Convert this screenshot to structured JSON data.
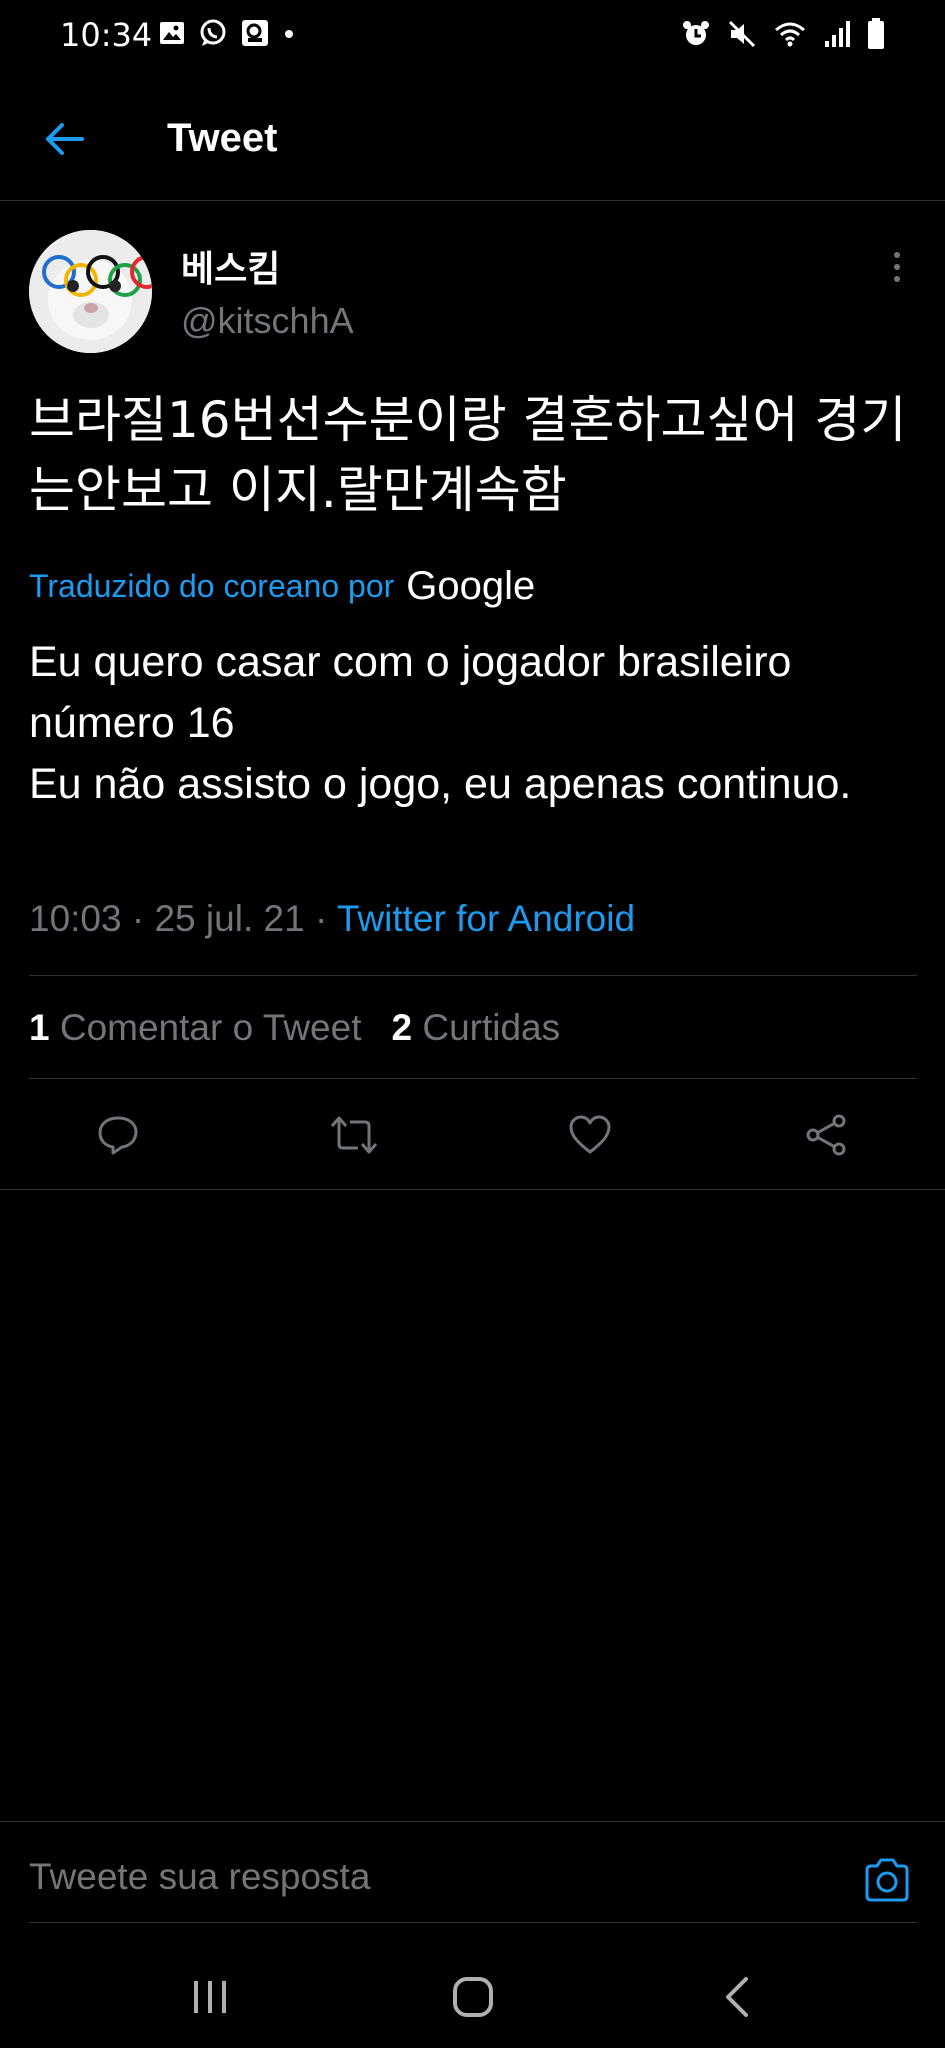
{
  "status_bar": {
    "time": "10:34",
    "left_icons": [
      "image-icon",
      "whatsapp-icon",
      "gallery-icon",
      "dot-icon"
    ],
    "right_icons": [
      "alarm-icon",
      "mute-icon",
      "wifi-icon",
      "signal-icon",
      "battery-icon"
    ]
  },
  "header": {
    "title": "Tweet",
    "back_icon": "arrow-left-icon"
  },
  "author": {
    "display_name": "베스킴",
    "handle": "@kitschhA"
  },
  "tweet": {
    "text": "브라질16번선수분이랑 결혼하고싶어 경기는안보고 이지.랄만계속함",
    "translated_by": "Traduzido do coreano por",
    "translator": "Google",
    "translation": "Eu quero casar com o jogador brasileiro número 16\n Eu não assisto o jogo, eu apenas continuo.",
    "time": "10:03",
    "date": "25 jul. 21",
    "source": "Twitter for Android"
  },
  "stats": {
    "comments_count": "1",
    "comments_label": "Comentar o Tweet",
    "likes_count": "2",
    "likes_label": "Curtidas"
  },
  "actions": [
    "reply-icon",
    "retweet-icon",
    "like-icon",
    "share-icon"
  ],
  "reply": {
    "placeholder": "Tweete sua resposta"
  },
  "colors": {
    "accent": "#1d9bf0",
    "background": "#000000",
    "muted": "#71767b",
    "divider": "#2f3336"
  }
}
